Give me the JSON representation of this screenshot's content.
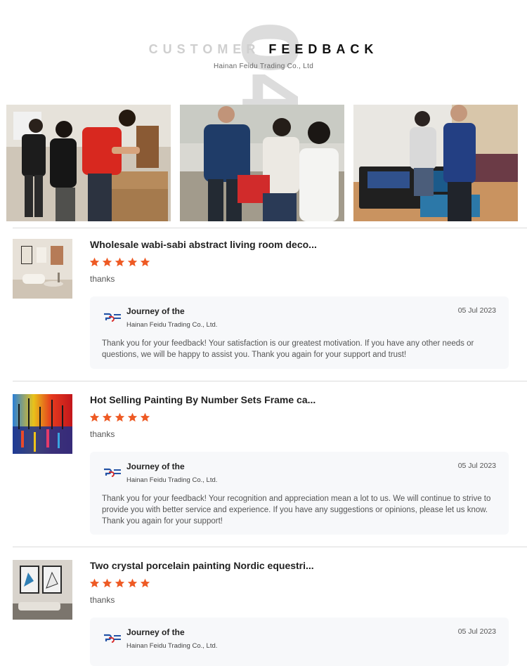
{
  "header": {
    "number": "04",
    "title_light": "CUSTOMER ",
    "title_dark": "FEEDBACK",
    "subtitle": "Hainan Feidu Trading Co., Ltd"
  },
  "colors": {
    "star": "#ee5a24",
    "divider": "#dcdcdc",
    "reply_bg": "#f7f8fa"
  },
  "reviews": [
    {
      "product_title": "Wholesale wabi-sabi abstract living room deco...",
      "rating": 5,
      "comment": "thanks",
      "reply": {
        "seller_name": "Journey of the",
        "company": "Hainan Feidu Trading Co., Ltd.",
        "date": "05 Jul 2023",
        "text": "Thank you for your feedback! Your satisfaction is our greatest motivation. If you have any other needs or questions, we will be happy to assist you. Thank you again for your support and trust!"
      }
    },
    {
      "product_title": "Hot Selling Painting By Number Sets Frame ca...",
      "rating": 5,
      "comment": "thanks",
      "reply": {
        "seller_name": "Journey of the",
        "company": "Hainan Feidu Trading Co., Ltd.",
        "date": "05 Jul 2023",
        "text": "Thank you for your feedback! Your recognition and appreciation mean a lot to us. We will continue to strive to provide you with better service and experience. If you have any suggestions or opinions, please let us know. Thank you again for your support!"
      }
    },
    {
      "product_title": "Two crystal porcelain painting Nordic equestri...",
      "rating": 5,
      "comment": "thanks",
      "reply": {
        "seller_name": "Journey of the",
        "company": "Hainan Feidu Trading Co., Ltd.",
        "date": "05 Jul 2023",
        "text": ""
      }
    }
  ]
}
